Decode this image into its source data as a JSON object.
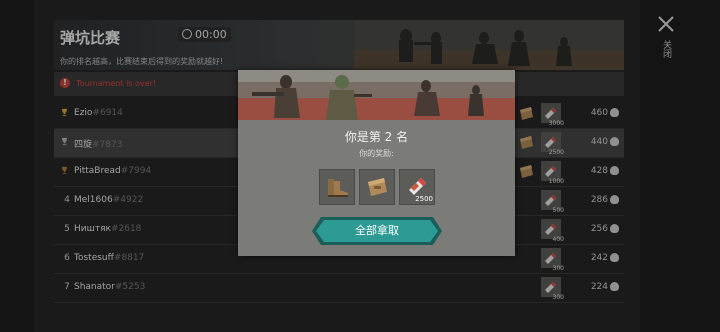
{
  "header": {
    "title": "弹坑比赛",
    "timer": "00:00",
    "subtitle": "你的排名越高，比赛结束后得到的奖励就越好!"
  },
  "notice": {
    "text": "Tournament is over!"
  },
  "close_label": "关闭",
  "rows": [
    {
      "rank": "",
      "trophy": "gold",
      "name": "Ezio",
      "tag": "#6914",
      "score": "460",
      "rewards": [
        "boots",
        "box",
        "bullets"
      ],
      "bullet_count": "3000"
    },
    {
      "rank": "",
      "trophy": "silver",
      "name": "四旋",
      "tag": "#7873",
      "score": "440",
      "rewards": [
        "boots",
        "box",
        "bullets"
      ],
      "bullet_count": "2500"
    },
    {
      "rank": "",
      "trophy": "bronze",
      "name": "PittaBread",
      "tag": "#7994",
      "score": "428",
      "rewards": [
        "boots",
        "box",
        "bullets"
      ],
      "bullet_count": "1000"
    },
    {
      "rank": "4",
      "trophy": "",
      "name": "Mel1606",
      "tag": "#4922",
      "score": "286",
      "rewards": [
        "bullets"
      ],
      "bullet_count": "500"
    },
    {
      "rank": "5",
      "trophy": "",
      "name": "Ништяк",
      "tag": "#2618",
      "score": "256",
      "rewards": [
        "bullets"
      ],
      "bullet_count": "400"
    },
    {
      "rank": "6",
      "trophy": "",
      "name": "Tostesuff",
      "tag": "#8817",
      "score": "242",
      "rewards": [
        "bullets"
      ],
      "bullet_count": "300"
    },
    {
      "rank": "7",
      "trophy": "",
      "name": "Shanator",
      "tag": "#5253",
      "score": "224",
      "rewards": [
        "bullets"
      ],
      "bullet_count": "300"
    }
  ],
  "modal": {
    "title": "你是第 2 名",
    "subtitle": "你的奖励:",
    "rewards": [
      {
        "icon": "boots-icon",
        "count": ""
      },
      {
        "icon": "box-icon",
        "count": ""
      },
      {
        "icon": "bullets-icon",
        "count": "2500"
      }
    ],
    "claim_label": "全部拿取"
  },
  "colors": {
    "accent": "#2d9a93",
    "alert": "#d9473f",
    "gold": "#d7a640",
    "silver": "#b8b8b8",
    "bronze": "#b07a42"
  }
}
